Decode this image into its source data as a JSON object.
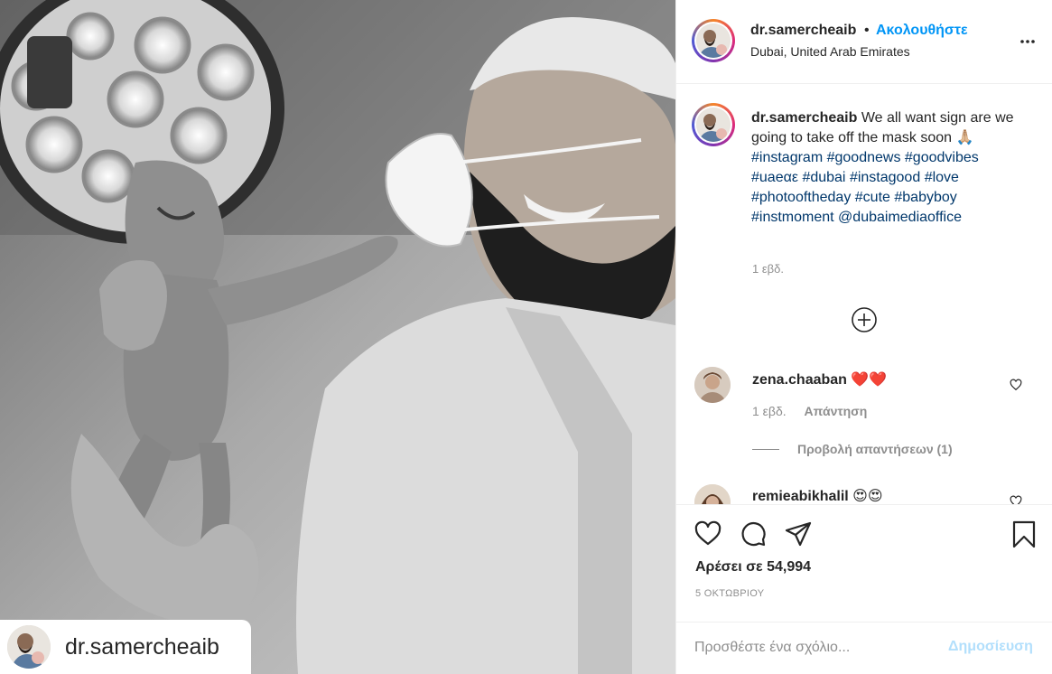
{
  "post": {
    "username": "dr.samercheaib",
    "separator": "•",
    "follow_label": "Ακολουθήστε",
    "location": "Dubai, United Arab Emirates",
    "more_icon": "more-horizontal-icon"
  },
  "caption": {
    "username": "dr.samercheaib",
    "text": "We all want sign are we going to take off the mask soon",
    "emoji": "🙏🏼",
    "hashtags": [
      "#instagram",
      "#goodnews",
      "#goodvibes",
      "#uaeαε",
      "#dubai",
      "#instagood",
      "#love",
      "#photooftheday",
      "#cute",
      "#babyboy",
      "#instmoment"
    ],
    "mention": "@dubaimediaoffice",
    "time": "1 εβδ."
  },
  "comments": [
    {
      "username": "zena.chaaban",
      "text": "❤️❤️",
      "time": "1 εβδ.",
      "reply_label": "Απάντηση",
      "view_replies": "Προβολή απαντήσεων (1)"
    },
    {
      "username": "remieabikhalil",
      "text": "😍😍"
    }
  ],
  "actions": {
    "likes_text": "Αρέσει σε 54,994",
    "date": "5 ΟΚΤΩΒΡΙΟΥ"
  },
  "add_comment": {
    "placeholder": "Προσθέστε ένα σχόλιο...",
    "post_label": "Δημοσίευση"
  },
  "photo": {
    "watermark_name": "dr.samercheaib"
  },
  "colors": {
    "link": "#00376b",
    "follow": "#0095f6",
    "post_disabled": "#b2dffc",
    "muted": "#8e8e8e"
  }
}
